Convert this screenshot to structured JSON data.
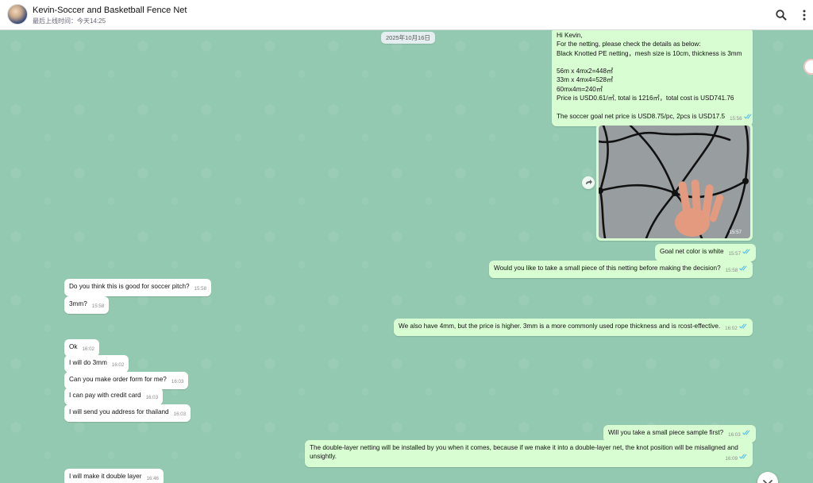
{
  "header": {
    "title": "Kevin-Soccer and Basketball Fence Net",
    "status": "最后上线时间：今天14:25",
    "search_icon": "search-icon",
    "menu_icon": "more-vertical-icon"
  },
  "colors": {
    "wallpaper": "#93c9b0",
    "incoming_bubble": "#ffffff",
    "outgoing_bubble": "#d9fdd3",
    "read_tick": "#53bdeb"
  },
  "chat": {
    "date_chip": "2025年10月16日",
    "quote": {
      "lines": [
        "Hi Kevin,",
        "For the netting, please check the details as below:",
        "Black Knotted PE netting，mesh size is 10cm, thickness is 3mm",
        "",
        "56m x 4mx2=448㎡",
        "33m x 4mx4=528㎡",
        "60mx4m=240㎡",
        "Price is USD0.61/㎡, total is 1216㎡，total cost is USD741.76",
        "",
        "The soccer goal net price is USD8.75/pc, 2pcs is USD17.5"
      ],
      "time": "15:56"
    },
    "image_message": {
      "time": "15:57",
      "forward_icon": "forward-icon"
    },
    "messages": [
      {
        "text": "Goal net color is white",
        "time": "15:57"
      },
      {
        "text": "Would you like to take a small piece of this netting before making the decision?",
        "time": "15:58"
      },
      {
        "text": "Do you think this is good for soccer pitch?",
        "time": "15:58"
      },
      {
        "text": "3mm?",
        "time": "15:58"
      },
      {
        "text": "We also have 4mm, but the price is higher. 3mm is a more commonly used rope thickness and is rcost-effective.",
        "time": "16:02"
      },
      {
        "text": "Ok",
        "time": "16:02"
      },
      {
        "text": "I will do 3mm",
        "time": "16:02"
      },
      {
        "text": "Can you make order form for me?",
        "time": "16:03"
      },
      {
        "text": "I can pay with credit card",
        "time": "16:03"
      },
      {
        "text": "I will send you address for thailand",
        "time": "16:03"
      },
      {
        "text": "Will you take a small piece sample first?",
        "time": "16:03"
      },
      {
        "line1": "The double-layer netting will be installed by you when it comes, because if we make it into a double-layer net, the knot position will be misaligned and",
        "line2": "unsightly.",
        "time": "16:09"
      },
      {
        "text": "I will make it double layer",
        "time": "16:46"
      }
    ],
    "scroll_down_icon": "chevron-down-icon"
  }
}
